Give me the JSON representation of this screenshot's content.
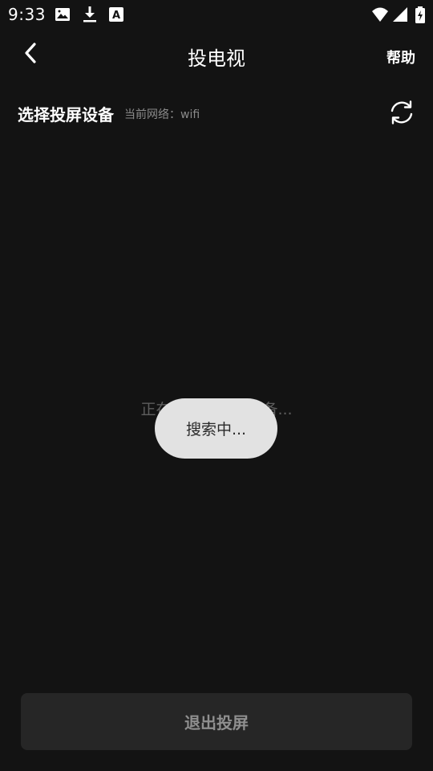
{
  "status_bar": {
    "time": "9:33",
    "icons": [
      "image-icon",
      "download-icon",
      "font-icon",
      "wifi-icon",
      "signal-icon",
      "battery-charging-icon"
    ]
  },
  "header": {
    "back_icon": "chevron-left-icon",
    "title": "投电视",
    "help_label": "帮助"
  },
  "section": {
    "title": "选择投屏设备",
    "network_label": "当前网络：wifi",
    "refresh_icon": "refresh-icon"
  },
  "content": {
    "searching_text": "正在搜索可连接设备..."
  },
  "toast": {
    "text": "搜索中..."
  },
  "footer": {
    "exit_label": "退出投屏"
  },
  "colors": {
    "background": "#131313",
    "toast_background": "#e2e2e2",
    "button_background": "#262626",
    "muted_text": "#8a8a8a"
  }
}
